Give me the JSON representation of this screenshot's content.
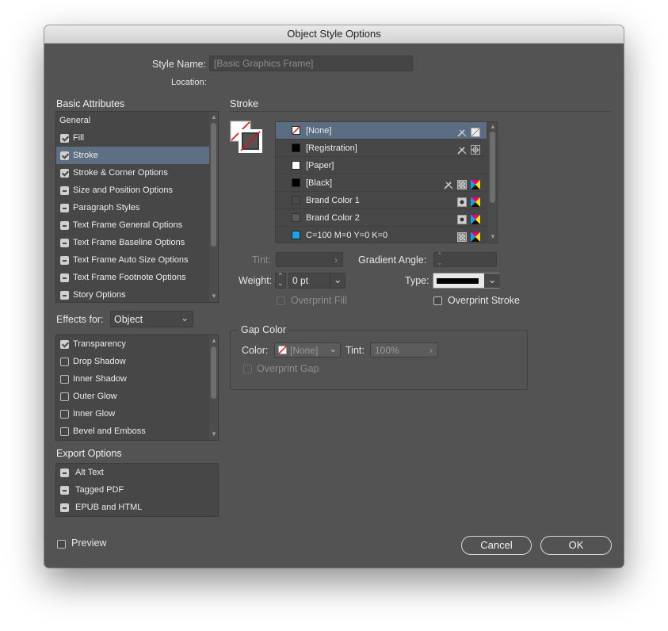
{
  "window": {
    "title": "Object Style Options"
  },
  "style_name": {
    "label": "Style Name:",
    "value": "[Basic Graphics Frame]"
  },
  "location": {
    "label": "Location:"
  },
  "basic_attributes": {
    "title": "Basic Attributes",
    "items": [
      {
        "label": "General",
        "state": "none"
      },
      {
        "label": "Fill",
        "state": "checked"
      },
      {
        "label": "Stroke",
        "state": "checked",
        "selected": true
      },
      {
        "label": "Stroke & Corner Options",
        "state": "checked"
      },
      {
        "label": "Size and Position Options",
        "state": "ignored"
      },
      {
        "label": "Paragraph Styles",
        "state": "ignored"
      },
      {
        "label": "Text Frame General Options",
        "state": "ignored"
      },
      {
        "label": "Text Frame Baseline Options",
        "state": "ignored"
      },
      {
        "label": "Text Frame Auto Size Options",
        "state": "ignored"
      },
      {
        "label": "Text Frame Footnote Options",
        "state": "ignored"
      },
      {
        "label": "Story Options",
        "state": "ignored"
      }
    ]
  },
  "effects_for": {
    "label": "Effects for:",
    "value": "Object",
    "items": [
      {
        "label": "Transparency",
        "state": "checked"
      },
      {
        "label": "Drop Shadow",
        "state": "unchecked"
      },
      {
        "label": "Inner Shadow",
        "state": "unchecked"
      },
      {
        "label": "Outer Glow",
        "state": "unchecked"
      },
      {
        "label": "Inner Glow",
        "state": "unchecked"
      },
      {
        "label": "Bevel and Emboss",
        "state": "unchecked"
      }
    ]
  },
  "export_options": {
    "title": "Export Options",
    "items": [
      {
        "label": "Alt Text",
        "state": "ignored"
      },
      {
        "label": "Tagged PDF",
        "state": "ignored"
      },
      {
        "label": "EPUB and HTML",
        "state": "ignored"
      }
    ]
  },
  "stroke": {
    "title": "Stroke",
    "swatches": [
      {
        "name": "[None]",
        "color": "none",
        "selected": true,
        "icons": [
          "pencil-crossed-icon",
          "none-icon"
        ]
      },
      {
        "name": "[Registration]",
        "color": "#000000",
        "icons": [
          "pencil-crossed-icon",
          "registration-icon"
        ]
      },
      {
        "name": "[Paper]",
        "color": "#ffffff",
        "icons": []
      },
      {
        "name": "[Black]",
        "color": "#000000",
        "icons": [
          "pencil-crossed-icon",
          "process-icon",
          "cmyk-icon"
        ]
      },
      {
        "name": "Brand Color 1",
        "color": "#4a4a4a",
        "icons": [
          "spot-icon",
          "cmyk-icon"
        ]
      },
      {
        "name": "Brand Color 2",
        "color": "#5a5a5a",
        "icons": [
          "spot-icon",
          "cmyk-icon"
        ]
      },
      {
        "name": "C=100 M=0 Y=0 K=0",
        "color": "#14a6e6",
        "icons": [
          "process-icon",
          "cmyk-icon"
        ]
      }
    ],
    "tint_label": "Tint:",
    "gradient_angle_label": "Gradient Angle:",
    "weight_label": "Weight:",
    "weight_value": "0 pt",
    "type_label": "Type:",
    "overprint_fill": "Overprint Fill",
    "overprint_stroke": "Overprint Stroke"
  },
  "gap_color": {
    "title": "Gap Color",
    "color_label": "Color:",
    "color_value": "[None]",
    "tint_label": "Tint:",
    "tint_value": "100%",
    "overprint_gap": "Overprint Gap"
  },
  "preview": {
    "label": "Preview"
  },
  "buttons": {
    "cancel": "Cancel",
    "ok": "OK"
  },
  "colors": {
    "accent_selection": "#5e6f84",
    "dialog_bg": "#535353",
    "field_bg": "#474747"
  }
}
